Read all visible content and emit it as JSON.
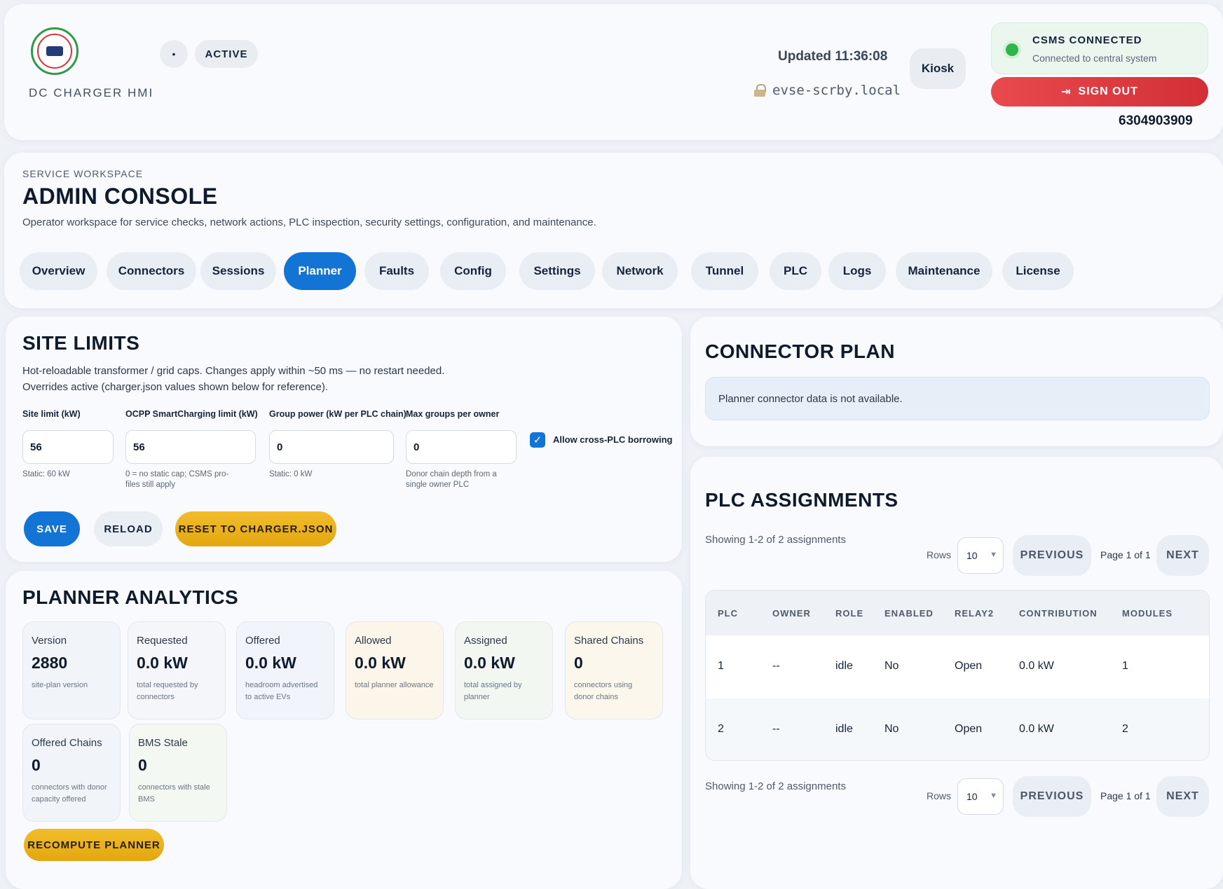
{
  "header": {
    "app_title": "DC CHARGER HMI",
    "dot_chip": "•",
    "status_chip": "ACTIVE",
    "updated": "Updated 11:36:08",
    "host": "evse-scrby.local",
    "kiosk_label": "Kiosk",
    "csms_title": "CSMS CONNECTED",
    "csms_sub": "Connected to central system",
    "signout_label": "SIGN OUT",
    "phone": "6304903909",
    "colors": {
      "csms_dot": "#2fb548",
      "signout": "#d23036"
    }
  },
  "admin": {
    "workspace_label": "SERVICE WORKSPACE",
    "title": "ADMIN CONSOLE",
    "description": "Operator workspace for service checks, network actions, PLC inspection, security settings, configuration, and maintenance.",
    "tabs": [
      {
        "label": "Overview"
      },
      {
        "label": "Connectors"
      },
      {
        "label": "Sessions"
      },
      {
        "label": "Planner"
      },
      {
        "label": "Faults"
      },
      {
        "label": "Config"
      },
      {
        "label": "Settings"
      },
      {
        "label": "Network"
      },
      {
        "label": "Tunnel"
      },
      {
        "label": "PLC"
      },
      {
        "label": "Logs"
      },
      {
        "label": "Maintenance"
      },
      {
        "label": "License"
      }
    ],
    "active_tab": "Planner",
    "accent": "#1274d4"
  },
  "site_limits": {
    "title": "SITE LIMITS",
    "desc1": "Hot-reloadable transformer / grid caps. Changes apply within ~50 ms — no restart needed.",
    "desc2": "Overrides active (charger.json values shown below for reference).",
    "fields": [
      {
        "label": "Site limit (kW)",
        "value": "56",
        "hint": "Static: 60 kW"
      },
      {
        "label": "OCPP SmartCharging limit (kW)",
        "value": "56",
        "hint": "0 = no static cap; CSMS pro-\nfiles still apply"
      },
      {
        "label": "Group power (kW per PLC chain)",
        "value": "0",
        "hint": "Static: 0 kW"
      },
      {
        "label": "Max groups per owner",
        "value": "0",
        "hint": "Donor chain depth from a\nsingle owner PLC"
      }
    ],
    "checkbox_label": "Allow cross-PLC borrowing",
    "checkbox_checked": true,
    "save_label": "SAVE",
    "reload_label": "RELOAD",
    "reset_label": "RESET TO CHARGER.JSON"
  },
  "analytics": {
    "title": "PLANNER ANALYTICS",
    "stats": [
      {
        "label": "Version",
        "value": "2880",
        "sub": "site-plan version",
        "tint": "#f1f5fa"
      },
      {
        "label": "Requested",
        "value": "0.0 kW",
        "sub": "total requested by connectors",
        "tint": "#f4f6fa"
      },
      {
        "label": "Offered",
        "value": "0.0 kW",
        "sub": "headroom advertised to active EVs",
        "tint": "#f1f5fb"
      },
      {
        "label": "Allowed",
        "value": "0.0 kW",
        "sub": "total planner allowance",
        "tint": "#fcf6ea"
      },
      {
        "label": "Assigned",
        "value": "0.0 kW",
        "sub": "total assigned by planner",
        "tint": "#f2f8f1"
      },
      {
        "label": "Shared Chains",
        "value": "0",
        "sub": "connectors using donor chains",
        "tint": "#fcf7ec"
      },
      {
        "label": "Offered Chains",
        "value": "0",
        "sub": "connectors with donor capacity offered",
        "tint": "#f1f5fa"
      },
      {
        "label": "BMS Stale",
        "value": "0",
        "sub": "connectors with stale BMS",
        "tint": "#f4f8f3"
      }
    ],
    "recompute_label": "RECOMPUTE PLANNER"
  },
  "connector_plan": {
    "title": "CONNECTOR PLAN",
    "note": "Planner connector data is not available."
  },
  "plc": {
    "title": "PLC ASSIGNMENTS",
    "showing": "Showing 1-2 of 2 assignments",
    "rows_label": "Rows",
    "rows_value": "10",
    "previous_label": "PREVIOUS",
    "page_text": "Page 1 of 1",
    "next_label": "NEXT",
    "columns": [
      "PLC",
      "OWNER",
      "ROLE",
      "ENABLED",
      "RELAY2",
      "CONTRIBUTION",
      "MODULES"
    ],
    "rows": [
      [
        "1",
        "--",
        "idle",
        "No",
        "Open",
        "0.0 kW",
        "1"
      ],
      [
        "2",
        "--",
        "idle",
        "No",
        "Open",
        "0.0 kW",
        "2"
      ]
    ]
  }
}
